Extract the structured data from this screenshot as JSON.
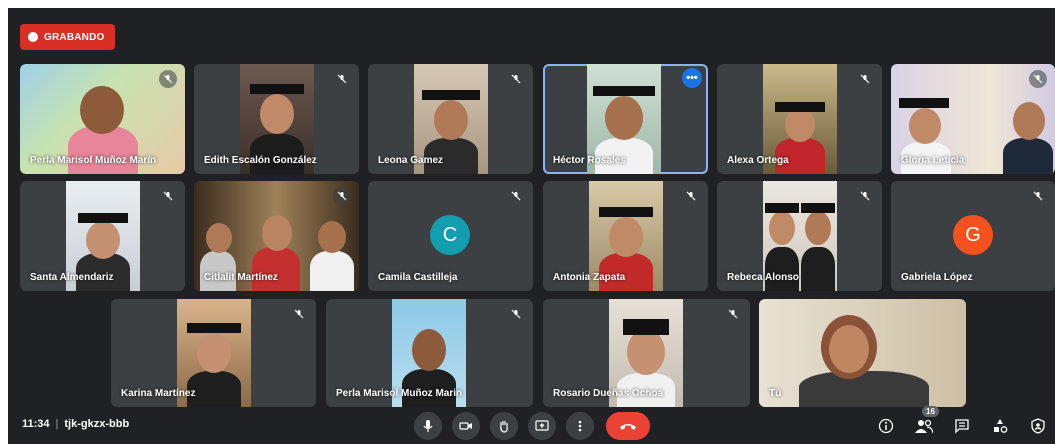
{
  "recording": {
    "label": "GRABANDO"
  },
  "tiles": [
    {
      "name": "Perla Marisol Muñoz Marín"
    },
    {
      "name": "Edith Escalón González"
    },
    {
      "name": "Leona Gamez"
    },
    {
      "name": "Héctor Rosales"
    },
    {
      "name": "Alexa Ortega"
    },
    {
      "name": "Gloria Leticia"
    },
    {
      "name": "Santa Almendariz"
    },
    {
      "name": "Citlalit Martínez"
    },
    {
      "name": "Camila Castilleja",
      "initial": "C",
      "color": "#129eaf"
    },
    {
      "name": "Antonia Zapata"
    },
    {
      "name": "Rebeca Alonso"
    },
    {
      "name": "Gabriela López",
      "initial": "G",
      "color": "#f4511e"
    },
    {
      "name": "Karina Martínez"
    },
    {
      "name": "Perla Marisol Muñoz Marin"
    },
    {
      "name": "Rosario Dueñas Ochoa"
    },
    {
      "name": "Tú"
    }
  ],
  "more_options": {
    "glyph": "•••"
  },
  "meeting": {
    "time": "11:34",
    "separator": "|",
    "code": "tjk-gkzx-bbb"
  },
  "participants": {
    "count": "16"
  },
  "controls": [
    {
      "icon": "mic-icon"
    },
    {
      "icon": "camera-icon"
    },
    {
      "icon": "raise-hand-icon"
    },
    {
      "icon": "present-screen-icon"
    },
    {
      "icon": "more-vert-icon"
    },
    {
      "icon": "end-call-icon"
    }
  ],
  "right_controls": [
    {
      "icon": "info-icon"
    },
    {
      "icon": "people-icon"
    },
    {
      "icon": "chat-icon"
    },
    {
      "icon": "activities-icon"
    },
    {
      "icon": "host-controls-icon"
    }
  ],
  "colors": {
    "background": "#202124",
    "tile": "#3c4043",
    "recording": "#d93025",
    "end_call": "#ea4335",
    "active_border": "#8ab4f8"
  }
}
